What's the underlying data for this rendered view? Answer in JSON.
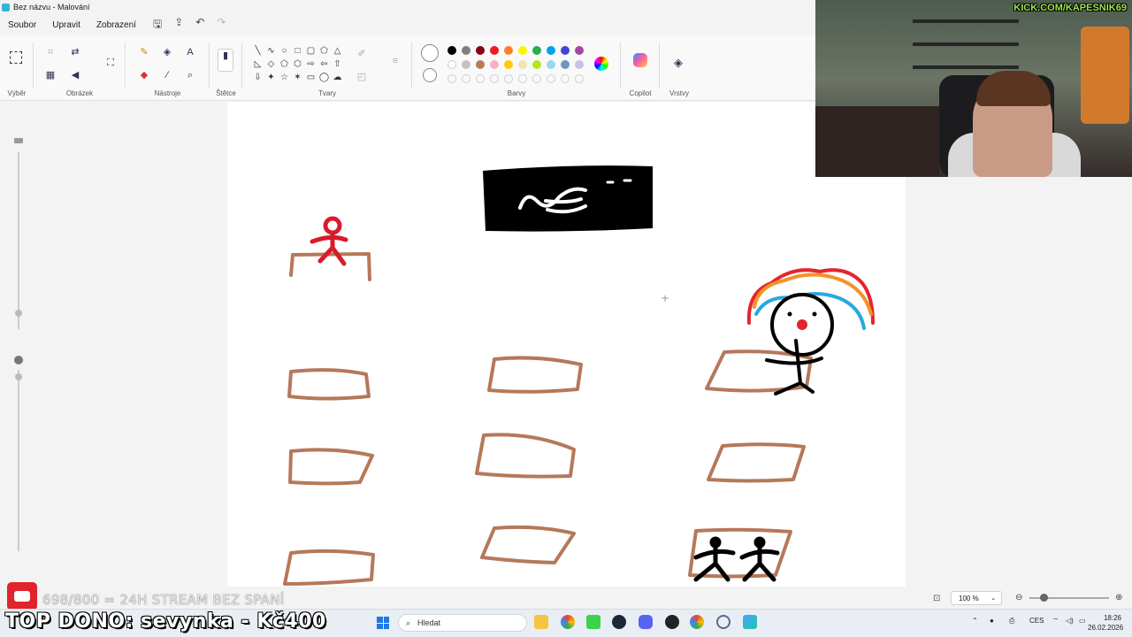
{
  "titlebar": {
    "title": "Bez názvu - Malování"
  },
  "menu": {
    "file": "Soubor",
    "edit": "Upravit",
    "view": "Zobrazení"
  },
  "ribbon": {
    "groups": {
      "selection": "Výběr",
      "image": "Obrázek",
      "tools": "Nástroje",
      "brushes": "Štětce",
      "shapes": "Tvary",
      "colors": "Barvy",
      "copilot": "Copilot",
      "layers": "Vrstvy"
    },
    "palette_row1": [
      "#000000",
      "#7f7f7f",
      "#880015",
      "#ed1c24",
      "#ff7f27",
      "#fff200",
      "#22b14c",
      "#00a2e8",
      "#3f48cc",
      "#a349a4"
    ],
    "palette_row2": [
      "#ffffff",
      "#c3c3c3",
      "#b97a57",
      "#ffaec9",
      "#ffc90e",
      "#efe4b0",
      "#b5e61d",
      "#99d9ea",
      "#7092be",
      "#c8bfe7"
    ]
  },
  "status": {
    "zoom": "100 %"
  },
  "overlay": {
    "kick_url": "KICK.COM/KAPESNIK69",
    "goal": "698/800 = 24H STREAM BEZ SPANÍ",
    "top_donor": "TOP DONO: sevynka - Kč400"
  },
  "taskbar": {
    "search_placeholder": "Hledat",
    "lang": "CES",
    "time": "18:26",
    "date": "26.02.2026"
  }
}
